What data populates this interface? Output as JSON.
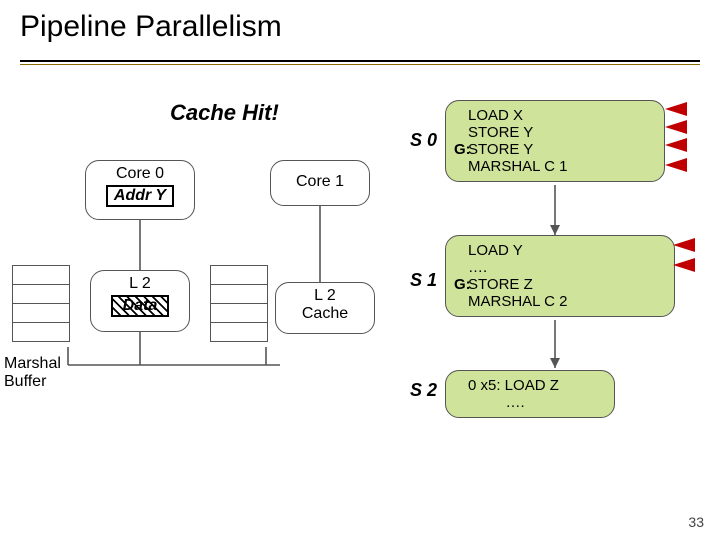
{
  "title": "Pipeline Parallelism",
  "cache_hit": "Cache Hit!",
  "core0": {
    "label": "Core 0",
    "addr": "Addr Y"
  },
  "core1": {
    "label": "Core 1"
  },
  "l2a": {
    "label": "L 2",
    "data": "Data"
  },
  "l2b": {
    "line1": "L 2",
    "line2": "Cache"
  },
  "marshal": "Marshal\nBuffer",
  "S_labels": {
    "s0": "S 0",
    "s1": "S 1",
    "s2": "S 2"
  },
  "stage0": {
    "l1": "LOAD X",
    "l2": "STORE Y",
    "g": "G:",
    "l3": "STORE Y",
    "l4": "MARSHAL C 1"
  },
  "stage1": {
    "l1": "LOAD Y",
    "l2": "….",
    "g": "G:",
    "l3": "STORE Z",
    "l4": "MARSHAL C 2"
  },
  "stage2": {
    "l1": "0 x5: LOAD Z",
    "l2": "         …."
  },
  "page_number": "33"
}
